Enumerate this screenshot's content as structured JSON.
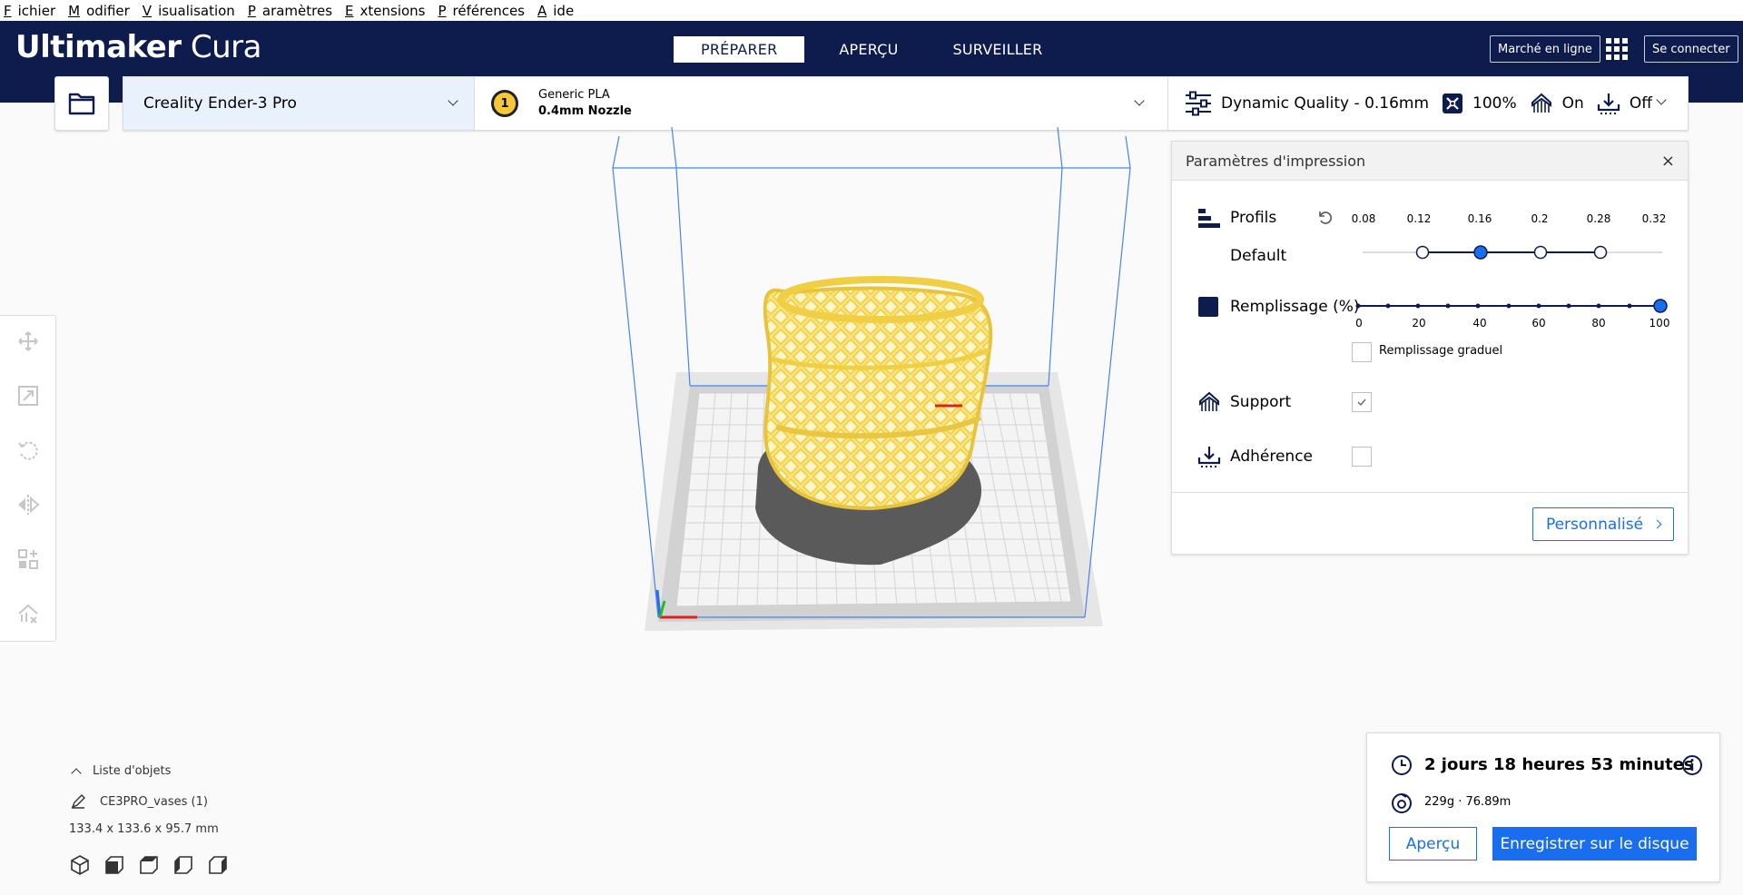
{
  "menubar": {
    "items": [
      {
        "key": "F",
        "rest": "ichier"
      },
      {
        "key": "M",
        "rest": "odifier"
      },
      {
        "key": "V",
        "rest": "isualisation"
      },
      {
        "key": "P",
        "rest": "aramètres"
      },
      {
        "key": "E",
        "rest": "xtensions"
      },
      {
        "key": "P",
        "rest": "références"
      },
      {
        "key": "A",
        "rest": "ide"
      }
    ]
  },
  "header": {
    "brand_bold": "Ultimaker",
    "brand_light": "Cura",
    "tabs": [
      {
        "label": "PRÉPARER",
        "active": true
      },
      {
        "label": "APERÇU",
        "active": false
      },
      {
        "label": "SURVEILLER",
        "active": false
      }
    ],
    "marketplace_label": "Marché en ligne",
    "signin_label": "Se connecter",
    "color": "#0e1b4d"
  },
  "toolbar": {
    "printer": "Creality Ender-3 Pro",
    "extruder_number": "1",
    "material": "Generic PLA",
    "nozzle": "0.4mm Nozzle",
    "quality": "Dynamic Quality - 0.16mm",
    "infill": "100%",
    "support": "On",
    "adhesion": "Off"
  },
  "settings": {
    "title": "Paramètres d'impression",
    "close": "×",
    "profiles_label": "Profils",
    "profile_name": "Default",
    "layer_heights": [
      "0.08",
      "0.12",
      "0.16",
      "0.2",
      "0.28",
      "0.32"
    ],
    "selected_layer_height": "0.16",
    "infill_label": "Remplissage (%)",
    "infill_ticks": [
      "0",
      "20",
      "40",
      "60",
      "80",
      "100"
    ],
    "infill_value": 100,
    "gradual_infill_label": "Remplissage graduel",
    "gradual_infill_checked": false,
    "support_label": "Support",
    "support_checked": true,
    "adhesion_label": "Adhérence",
    "adhesion_checked": false,
    "custom_button": "Personnalisé"
  },
  "object_list": {
    "header": "Liste d'objets",
    "object_name": "CE3PRO_vases (1)",
    "dimensions": "133.4 x 133.6 x 95.7 mm"
  },
  "action_panel": {
    "print_time": "2 jours 18 heures 53 minutes",
    "material_usage": "229g · 76.89m",
    "preview_button": "Aperçu",
    "save_button": "Enregistrer sur le disque"
  },
  "colors": {
    "accent": "#196ef0",
    "model": "#f7dc6a",
    "build_volume": "#4a82e8"
  }
}
